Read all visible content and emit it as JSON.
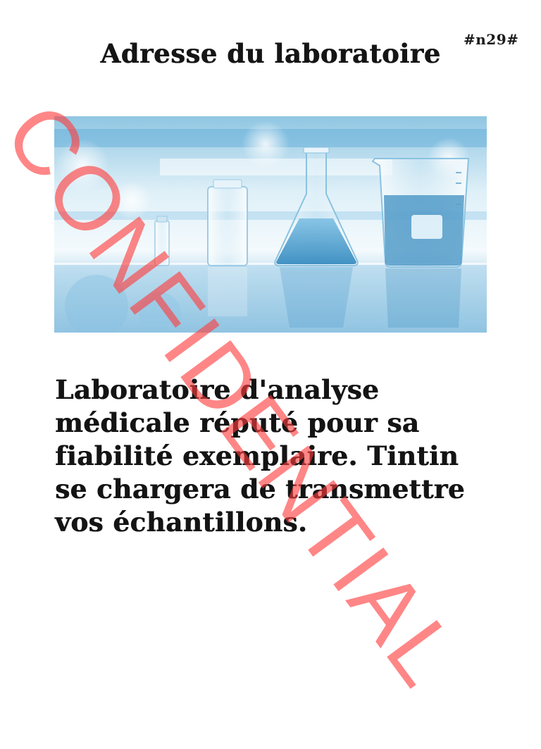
{
  "document": {
    "tag": "#n29#",
    "title": "Adresse du laboratoire",
    "photo": {
      "icon": "lab-glassware-photo",
      "colors": {
        "backdrop": "#cfe6f2",
        "liquid": "#2f87bd",
        "accent": "#0a8fc8"
      }
    },
    "body": "Laboratoire d'analyse médicale réputé pour sa fiabilité exemplaire. Tintin se chargera de transmettre vos échantillons.",
    "watermark": {
      "text": "CONFIDENTIAL",
      "color": "#ff3b3b"
    }
  }
}
